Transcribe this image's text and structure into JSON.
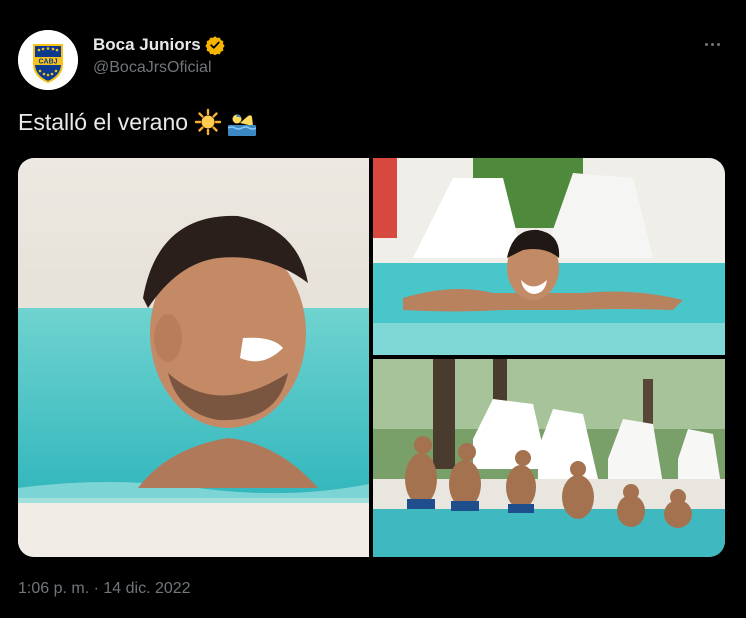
{
  "author": {
    "display_name": "Boca Juniors",
    "handle": "@BocaJrsOficial",
    "avatar_text": "CABJ",
    "verified_color": "#f4b400"
  },
  "tweet": {
    "text": "Estalló el verano",
    "emojis": [
      "sun-emoji",
      "swimmer-emoji"
    ],
    "timestamp": "1:06 p. m. · 14 dic. 2022"
  },
  "media": [
    {
      "name": "photo-player-closeup-pool"
    },
    {
      "name": "photo-player-swimming"
    },
    {
      "name": "photo-players-poolside-group"
    }
  ],
  "colors": {
    "background": "#000000",
    "text_primary": "#e7e9ea",
    "text_secondary": "#71767b",
    "boca_blue": "#0b3a8f",
    "boca_gold": "#f6c21b",
    "pool": "#3fc1c4"
  }
}
